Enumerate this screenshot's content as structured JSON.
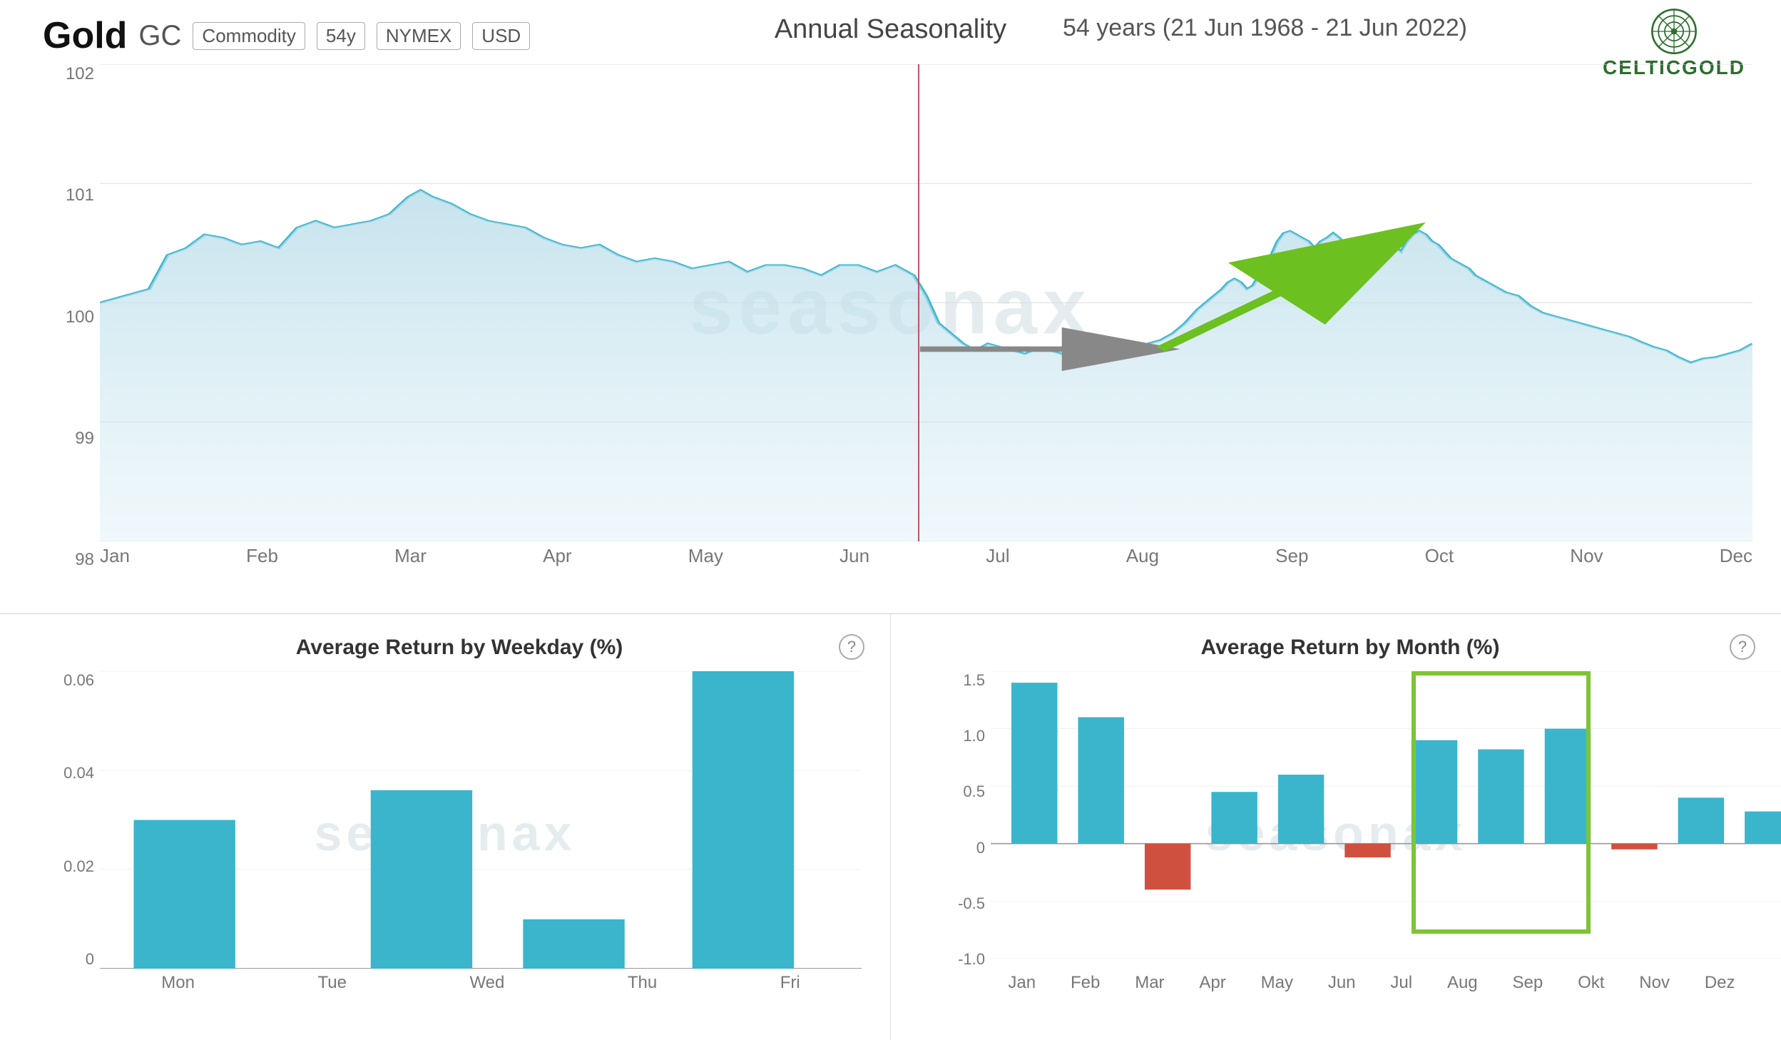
{
  "header": {
    "title": "Gold",
    "ticker": "GC",
    "tags": [
      "Commodity",
      "54y",
      "NYMEX",
      "USD"
    ],
    "center_title": "Annual Seasonality",
    "date_range": "54 years (21 Jun 1968 - 21 Jun 2022)"
  },
  "top_chart": {
    "y_labels": [
      "102",
      "101",
      "100",
      "99",
      "98"
    ],
    "x_labels": [
      "Jan",
      "Feb",
      "Mar",
      "Apr",
      "May",
      "Jun",
      "Jul",
      "Aug",
      "Sep",
      "Oct",
      "Nov",
      "Dec"
    ],
    "watermark": "seasonax"
  },
  "bottom_left": {
    "title": "Average Return by Weekday (%)",
    "y_labels": [
      "0.06",
      "0.04",
      "0.02",
      "0"
    ],
    "x_labels": [
      "Mon",
      "Tue",
      "Wed",
      "Thu",
      "Fri"
    ],
    "bars": [
      {
        "label": "Mon",
        "value": 0.03,
        "positive": true
      },
      {
        "label": "Tue",
        "value": 0,
        "positive": true
      },
      {
        "label": "Wed",
        "value": 0.036,
        "positive": true
      },
      {
        "label": "Thu",
        "value": 0.01,
        "positive": true
      },
      {
        "label": "Fri",
        "value": 0.06,
        "positive": true
      }
    ],
    "watermark": "seasonax"
  },
  "bottom_right": {
    "title": "Average Return by Month (%)",
    "y_labels": [
      "1.5",
      "1.0",
      "0.5",
      "0",
      "-0.5",
      "-1.0"
    ],
    "x_labels": [
      "Jan",
      "Feb",
      "Mar",
      "Apr",
      "May",
      "Jun",
      "Jul",
      "Aug",
      "Sep",
      "Okt",
      "Nov",
      "Dez"
    ],
    "bars": [
      {
        "label": "Jan",
        "value": 1.4,
        "positive": true
      },
      {
        "label": "Feb",
        "value": 1.1,
        "positive": true
      },
      {
        "label": "Mar",
        "value": -0.4,
        "positive": false
      },
      {
        "label": "Apr",
        "value": 0.45,
        "positive": true
      },
      {
        "label": "May",
        "value": 0.6,
        "positive": true
      },
      {
        "label": "Jun",
        "value": -0.12,
        "positive": false
      },
      {
        "label": "Jul",
        "value": 0.9,
        "positive": true
      },
      {
        "label": "Aug",
        "value": 0.82,
        "positive": true
      },
      {
        "label": "Sep",
        "value": 1.0,
        "positive": true
      },
      {
        "label": "Okt",
        "value": -0.05,
        "positive": false
      },
      {
        "label": "Nov",
        "value": 0.4,
        "positive": true
      },
      {
        "label": "Dez",
        "value": 0.28,
        "positive": true
      }
    ],
    "watermark": "seasonax",
    "highlight": {
      "start_index": 6,
      "end_index": 8
    }
  }
}
